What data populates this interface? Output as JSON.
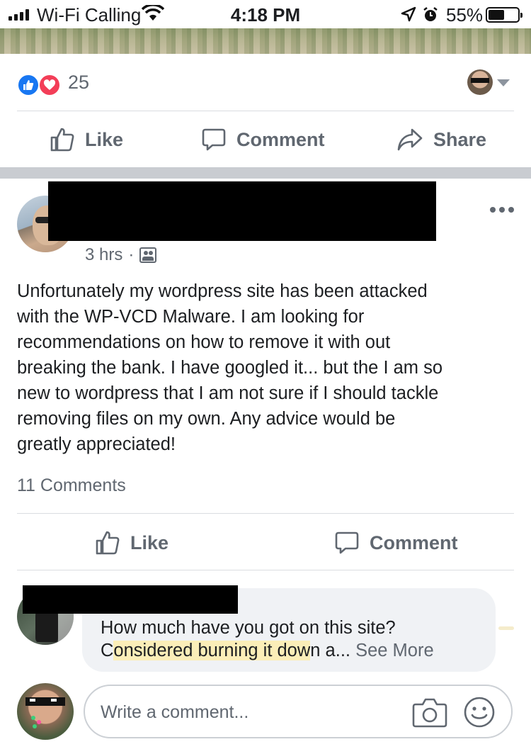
{
  "status_bar": {
    "carrier": "Wi-Fi Calling",
    "time": "4:18 PM",
    "battery": "55%",
    "battery_level": 0.55
  },
  "reactions": {
    "count": "25",
    "types": [
      "like-icon",
      "love-icon"
    ]
  },
  "top_actions": {
    "like": "Like",
    "comment": "Comment",
    "share": "Share"
  },
  "post": {
    "time": "3 hrs",
    "separator": "·",
    "text": "Unfortunately my wordpress site has been attacked\nwith the WP-VCD Malware.  I am looking for\nrecommendations on how to remove it with out\nbreaking the bank.  I have googled it... but the I am so\nnew to wordpress that I am not sure if I should tackle\nremoving files on my own.  Any advice would be\ngreatly appreciated!",
    "comments_count": "11 Comments",
    "actions": {
      "like": "Like",
      "comment": "Comment"
    }
  },
  "comment": {
    "line1": "How much have you got on this site?",
    "line2_pre": "C",
    "line2_highlight": "onsidered burning it dow",
    "line2_post": "n a...",
    "see_more": "See More"
  },
  "composer": {
    "placeholder": "Write a comment..."
  }
}
